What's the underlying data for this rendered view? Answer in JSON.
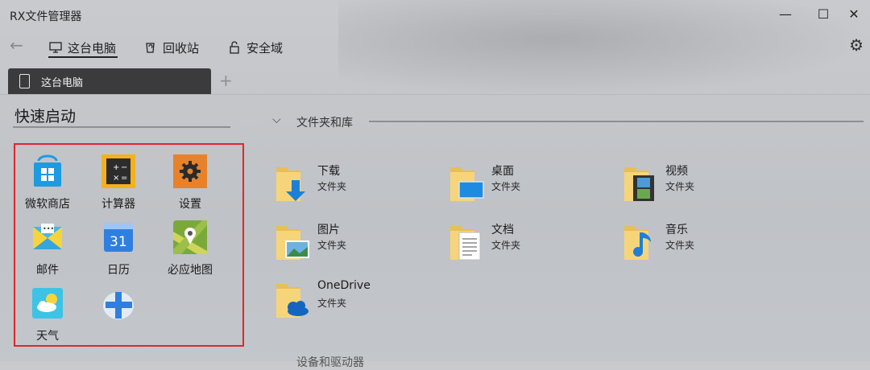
{
  "app": {
    "title": "RX文件管理器"
  },
  "window": {
    "minimize": "—",
    "maximize": "☐",
    "close": "✕"
  },
  "nav": {
    "back_icon": "←",
    "items": [
      {
        "label": "这台电脑",
        "icon": "computer-icon"
      },
      {
        "label": "回收站",
        "icon": "recycle-bin-icon"
      },
      {
        "label": "安全域",
        "icon": "lock-icon"
      }
    ],
    "settings_icon": "⚙"
  },
  "tabs": {
    "items": [
      {
        "label": "这台电脑"
      }
    ],
    "add_icon": "+"
  },
  "quick_launch": {
    "title": "快速启动",
    "apps": [
      {
        "label": "微软商店",
        "icon": "store-icon"
      },
      {
        "label": "计算器",
        "icon": "calculator-icon"
      },
      {
        "label": "设置",
        "icon": "settings-icon"
      },
      {
        "label": "邮件",
        "icon": "mail-icon"
      },
      {
        "label": "日历",
        "icon": "calendar-icon",
        "day": "31"
      },
      {
        "label": "必应地图",
        "icon": "map-icon"
      },
      {
        "label": "天气",
        "icon": "weather-icon"
      },
      {
        "label": "",
        "icon": "add-icon"
      }
    ],
    "highlight_color": "#e0262f"
  },
  "folders_section": {
    "title": "文件夹和库",
    "folders": [
      {
        "name": "下载",
        "type": "文件夹",
        "icon": "downloads-folder-icon"
      },
      {
        "name": "桌面",
        "type": "文件夹",
        "icon": "desktop-folder-icon"
      },
      {
        "name": "视频",
        "type": "文件夹",
        "icon": "videos-folder-icon"
      },
      {
        "name": "图片",
        "type": "文件夹",
        "icon": "pictures-folder-icon"
      },
      {
        "name": "文档",
        "type": "文件夹",
        "icon": "documents-folder-icon"
      },
      {
        "name": "音乐",
        "type": "文件夹",
        "icon": "music-folder-icon"
      },
      {
        "name": "OneDrive",
        "type": "文件夹",
        "icon": "onedrive-folder-icon"
      }
    ]
  },
  "devices_section": {
    "title": "设备和驱动器"
  }
}
